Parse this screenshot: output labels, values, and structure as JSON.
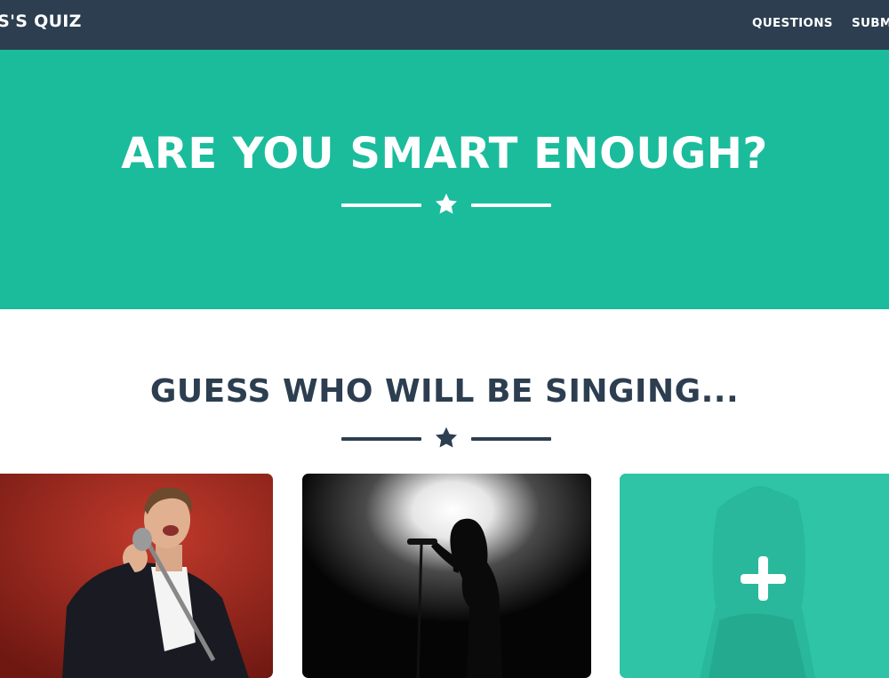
{
  "navbar": {
    "brand": "SS'S QUIZ",
    "links": [
      "QUESTIONS",
      "SUBM"
    ]
  },
  "hero": {
    "title": "ARE YOU SMART ENOUGH?"
  },
  "section": {
    "title": "GUESS WHO WILL BE SINGING..."
  },
  "colors": {
    "navbar": "#2c3e50",
    "accent": "#1abc9c",
    "heading": "#2c3e50"
  },
  "icons": {
    "divider": "star-icon",
    "card_overlay": "plus-icon"
  }
}
